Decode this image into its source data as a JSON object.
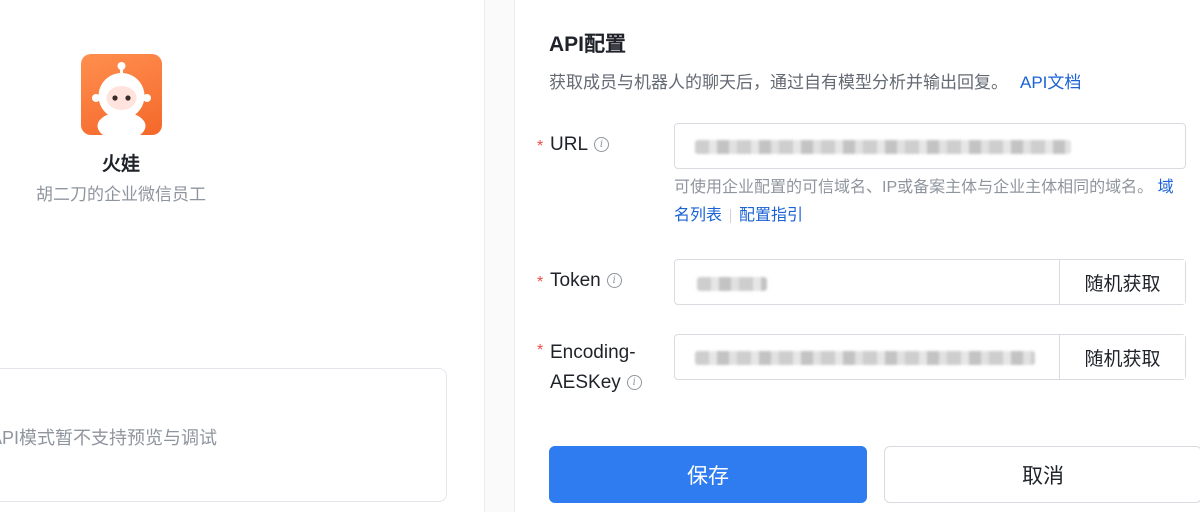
{
  "bot": {
    "name": "火娃",
    "description": "胡二刀的企业微信员工",
    "avatar_icon": "robot-mascot-icon",
    "avatar_color": "#f4682a"
  },
  "preview": {
    "message": "API模式暂不支持预览与调试"
  },
  "api_config": {
    "title": "API配置",
    "description": "获取成员与机器人的聊天后，通过自有模型分析并输出回复。",
    "doc_link": "API文档",
    "fields": {
      "url": {
        "label": "URL",
        "required_mark": "*",
        "info_icon": "info-circle-icon",
        "hint_text": "可使用企业配置的可信域名、IP或备案主体与企业主体相同的域名。",
        "hint_link_1": "域名列表",
        "hint_link_2": "配置指引"
      },
      "token": {
        "label": "Token",
        "required_mark": "*",
        "info_icon": "info-circle-icon",
        "button": "随机获取"
      },
      "aes_key": {
        "label_line1": "Encoding-",
        "label_line2": "AESKey",
        "required_mark": "*",
        "info_icon": "info-circle-icon",
        "button": "随机获取"
      }
    }
  },
  "actions": {
    "save": "保存",
    "cancel": "取消"
  },
  "colors": {
    "primary": "#2f7cf0",
    "link": "#1a62d6",
    "required": "#f54a45"
  }
}
